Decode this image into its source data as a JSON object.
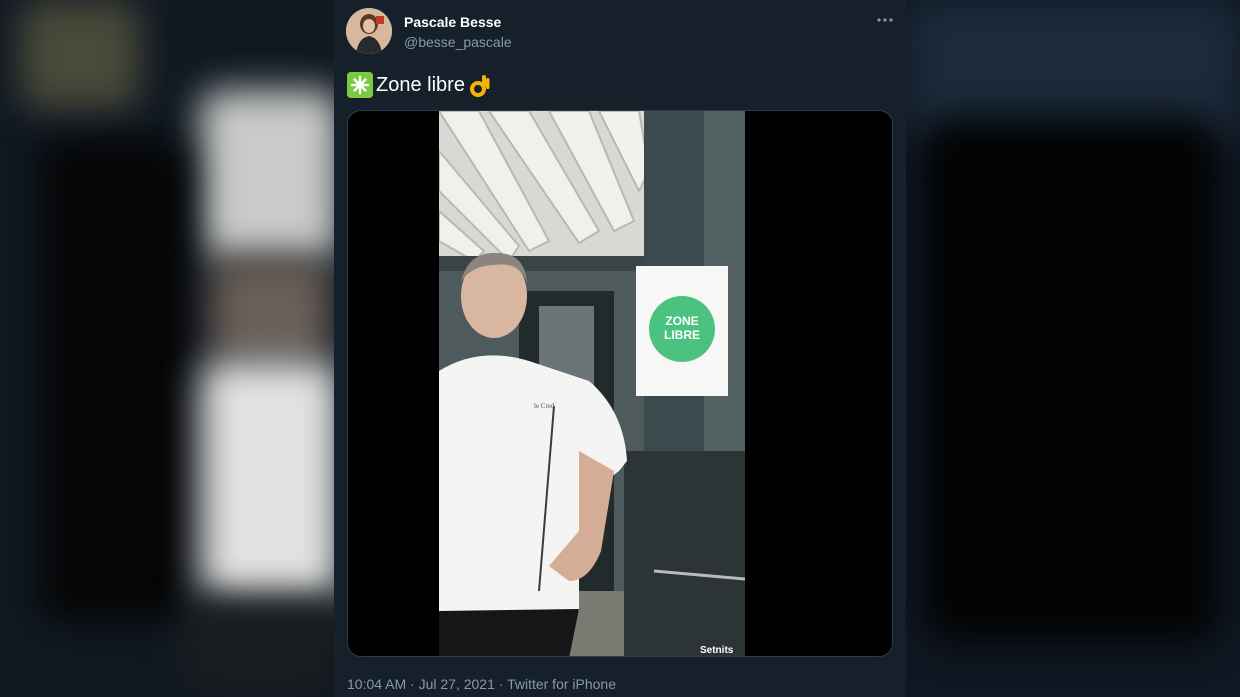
{
  "tweet": {
    "author": {
      "display_name": "Pascale Besse",
      "handle": "@besse_pascale"
    },
    "text": "Zone libre",
    "text_icons": [
      "sparkle-icon",
      "ok-hand-icon"
    ],
    "media": {
      "type": "video",
      "poster_label": "ZONE LIBRE",
      "watermark": "Setnits"
    },
    "timestamp": "10:04 AM · Jul 27, 2021 · Twitter for iPhone",
    "more_icon": "more-options-icon"
  },
  "colors": {
    "background": "#15202b",
    "text_primary": "#ffffff",
    "text_secondary": "#8899a6",
    "accent_green": "#7ac943"
  }
}
